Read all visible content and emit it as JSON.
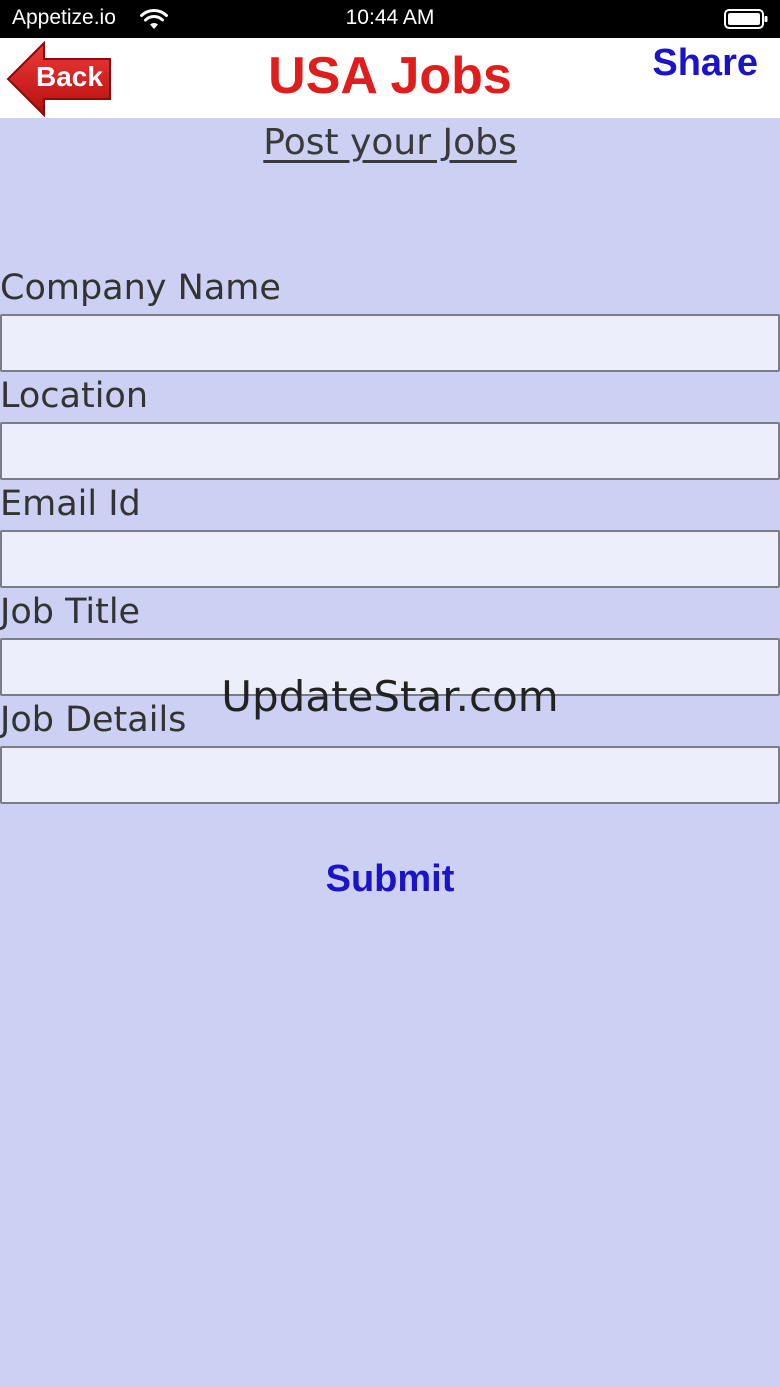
{
  "status_bar": {
    "carrier": "Appetize.io",
    "time": "10:44 AM"
  },
  "nav": {
    "back_label": "Back",
    "title": "USA Jobs",
    "share_label": "Share"
  },
  "page": {
    "title": "Post your Jobs"
  },
  "form": {
    "fields": [
      {
        "label": "Company Name",
        "value": ""
      },
      {
        "label": "Location",
        "value": ""
      },
      {
        "label": "Email Id",
        "value": ""
      },
      {
        "label": "Job Title",
        "value": ""
      },
      {
        "label": "Job Details",
        "value": ""
      }
    ],
    "submit_label": "Submit"
  },
  "watermark": "UpdateStar.com",
  "colors": {
    "background": "#ccd0f2",
    "title_red": "#e01d1d",
    "link_blue": "#1b12c9",
    "back_button_red": "#d61a1a",
    "input_fill": "#eceefb"
  },
  "icons": [
    "wifi-icon",
    "battery-icon",
    "back-arrow-icon"
  ]
}
